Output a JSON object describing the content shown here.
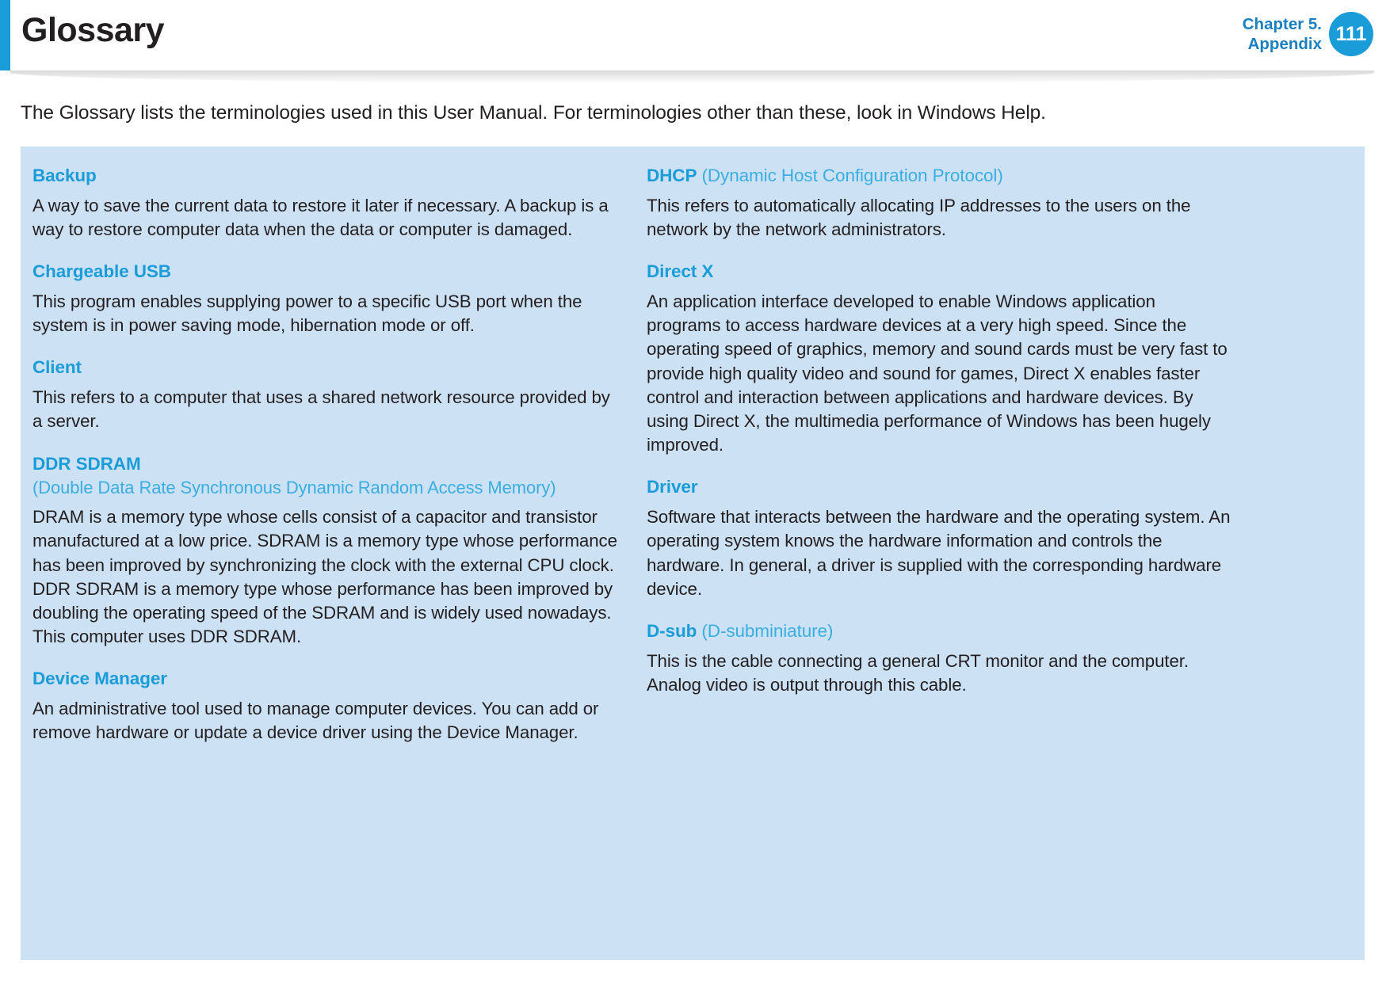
{
  "header": {
    "title": "Glossary",
    "chapter_line1": "Chapter 5.",
    "chapter_line2": "Appendix",
    "page_number": "111",
    "accent_color": "#1a9cd8",
    "chapter_color": "#1a7fc1"
  },
  "intro": "The Glossary lists the terminologies used in this User Manual. For terminologies other than these, look in Windows Help.",
  "panel": {
    "background_color": "#cde1f4",
    "heading_color": "#1a9cd8",
    "subtitle_color": "#3aaee0",
    "body_color": "#231f20"
  },
  "left_column": [
    {
      "term": "Backup",
      "expansion": "",
      "subtitle": "",
      "body": "A way to save the current data to restore it later if necessary. A backup is a way to restore computer data when the data or computer is damaged."
    },
    {
      "term": "Chargeable USB",
      "expansion": "",
      "subtitle": "",
      "body": "This program enables supplying power to a specific USB port when the system is in power saving mode, hibernation mode or off."
    },
    {
      "term": "Client",
      "expansion": "",
      "subtitle": "",
      "body": "This refers to a computer that uses a shared network resource provided by a server."
    },
    {
      "term": "DDR SDRAM",
      "expansion": "",
      "subtitle": "(Double Data Rate Synchronous Dynamic Random Access Memory)",
      "body": "DRAM is a memory type whose cells consist of a capacitor and transistor manufactured at a low price. SDRAM is a memory type whose performance has been improved by synchronizing the clock with the external CPU clock. DDR SDRAM is a memory type whose performance has been improved by doubling the operating speed of the SDRAM and is widely used nowadays. This computer uses DDR SDRAM."
    },
    {
      "term": "Device Manager",
      "expansion": "",
      "subtitle": "",
      "body": "An administrative tool used to manage computer devices. You can add or remove hardware or update a device driver using the Device Manager."
    }
  ],
  "right_column": [
    {
      "term": "DHCP",
      "expansion": " (Dynamic Host Configuration Protocol)",
      "subtitle": "",
      "body": "This refers to automatically allocating IP addresses to the users on the network by the network administrators."
    },
    {
      "term": "Direct X",
      "expansion": "",
      "subtitle": "",
      "body": "An application interface developed to enable Windows application programs to access hardware devices at a very high speed. Since the operating speed of graphics, memory and sound cards must be very fast to provide high quality video and sound for games, Direct X enables faster control and interaction between applications and hardware devices. By using Direct X, the multimedia performance of Windows has been hugely improved."
    },
    {
      "term": "Driver",
      "expansion": "",
      "subtitle": "",
      "body": "Software that interacts between the hardware and the operating system. An operating system knows the hardware information and controls the hardware. In general, a driver is supplied with the corresponding hardware device."
    },
    {
      "term": "D-sub",
      "expansion": " (D-subminiature)",
      "subtitle": "",
      "body": "This is the cable connecting a general CRT monitor and the computer. Analog video is output through this cable."
    }
  ]
}
